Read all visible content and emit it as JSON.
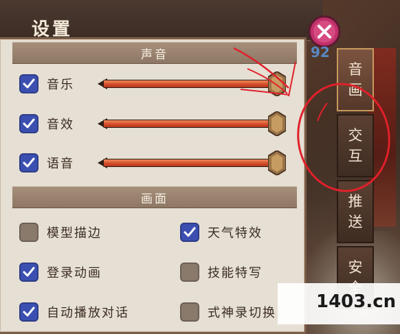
{
  "title": "设置",
  "sections": {
    "sound": "声音",
    "graphics": "画面"
  },
  "sound_rows": [
    {
      "label": "音乐",
      "checked": true,
      "level": 0.95
    },
    {
      "label": "音效",
      "checked": true,
      "level": 0.95
    },
    {
      "label": "语音",
      "checked": true,
      "level": 0.95
    }
  ],
  "graphics_options": [
    {
      "label": "模型描边",
      "checked": false
    },
    {
      "label": "天气特效",
      "checked": true
    },
    {
      "label": "登录动画",
      "checked": true
    },
    {
      "label": "技能特写",
      "checked": false
    },
    {
      "label": "自动播放对话",
      "checked": true
    },
    {
      "label": "式神录切换",
      "checked": false
    }
  ],
  "tabs": [
    {
      "label": "音画",
      "active": true
    },
    {
      "label": "交互",
      "active": false
    },
    {
      "label": "推送",
      "active": false
    },
    {
      "label": "安全",
      "active": false
    }
  ],
  "watermarks": {
    "top": "92",
    "bottom": "1403.cn"
  },
  "colors": {
    "accent_blue": "#3a4fb0",
    "slider_fill": "#d24a28",
    "annotation_red": "#e0202a",
    "close_magenta": "#c0306a"
  }
}
